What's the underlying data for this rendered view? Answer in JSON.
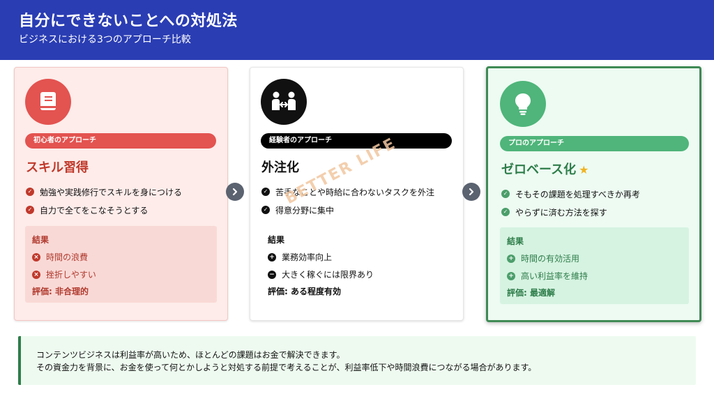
{
  "header": {
    "title": "自分にできないことへの対処法",
    "subtitle": "ビジネスにおける3つのアプローチ比較"
  },
  "cards": [
    {
      "icon": "book-icon",
      "badge": "初心者のアプローチ",
      "heading": "スキル習得",
      "points": [
        "勉強や実践修行でスキルを身につける",
        "自力で全てをこなそうとする"
      ],
      "result_title": "結果",
      "results": [
        {
          "icon": "x-circle-icon",
          "text": "時間の浪費"
        },
        {
          "icon": "x-circle-icon",
          "text": "挫折しやすい"
        }
      ],
      "evaluation": "評価: 非合理的"
    },
    {
      "icon": "people-handshake-icon",
      "badge": "経験者のアプローチ",
      "heading": "外注化",
      "points": [
        "苦手なことや時給に合わないタスクを外注",
        "得意分野に集中"
      ],
      "result_title": "結果",
      "results": [
        {
          "icon": "plus-circle-icon",
          "text": "業務効率向上"
        },
        {
          "icon": "minus-circle-icon",
          "text": "大きく稼ぐには限界あり"
        }
      ],
      "evaluation": "評価: ある程度有効"
    },
    {
      "icon": "lightbulb-icon",
      "badge": "プロのアプローチ",
      "heading": "ゼロベース化",
      "points": [
        "そもその課題を処理すべきか再考",
        "やらずに済む方法を探す"
      ],
      "result_title": "結果",
      "results": [
        {
          "icon": "plus-circle-icon",
          "text": "時間の有効活用"
        },
        {
          "icon": "plus-circle-icon",
          "text": "高い利益率を維持"
        }
      ],
      "evaluation": "評価: 最適解"
    }
  ],
  "watermark": "BETTER LIFE",
  "note": {
    "line1": "コンテンツビジネスは利益率が高いため、ほとんどの課題はお金で解決できます。",
    "line2": "その資金力を背景に、お金を使って何とかしようと対処する前提で考えることが、利益率低下や時間浪費につながる場合があります。"
  },
  "colors": {
    "header": "#2a3db3",
    "beginner": "#e35350",
    "experienced": "#000000",
    "pro": "#4fb57a"
  }
}
